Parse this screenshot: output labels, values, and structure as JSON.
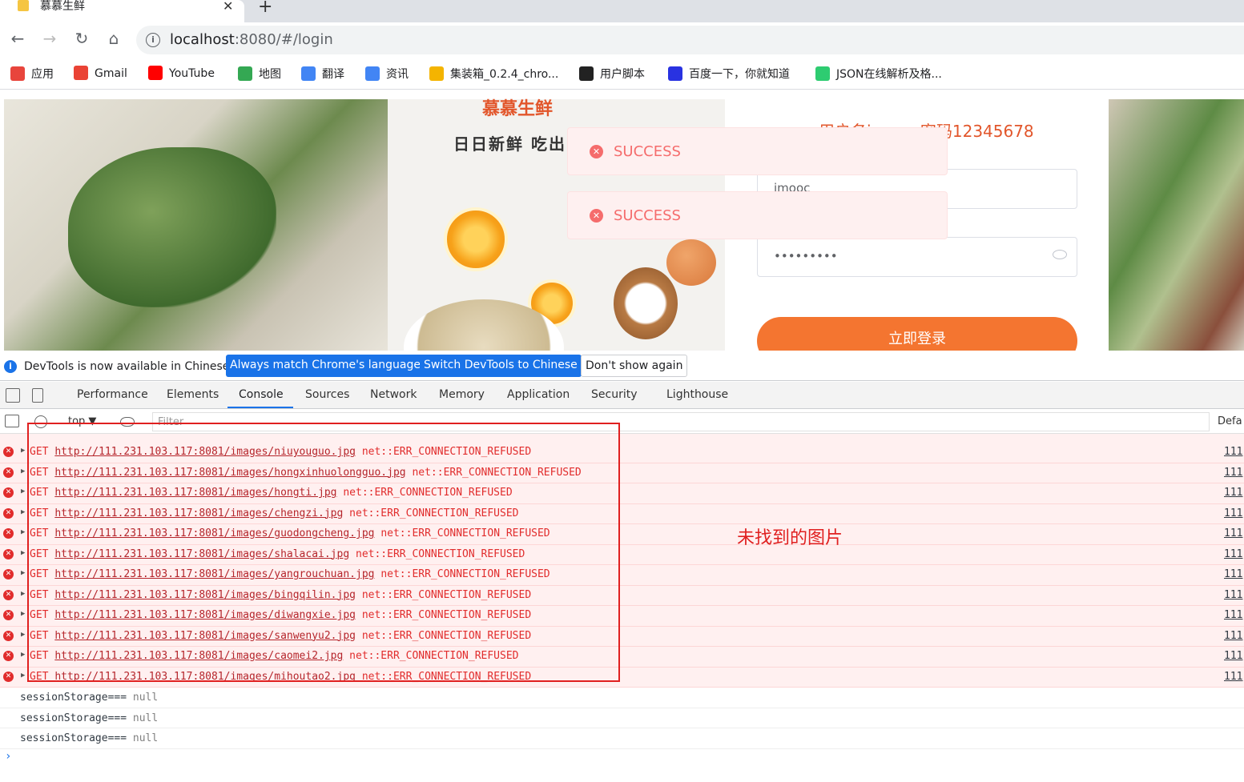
{
  "browser": {
    "tab_title": "慕慕生鲜",
    "url_host": "localhost",
    "url_rest": ":8080/#/login"
  },
  "bookmarks": [
    {
      "label": "应用",
      "icon": "apps-grid-icon",
      "color": "#e8453c"
    },
    {
      "label": "Gmail",
      "icon": "gmail-icon",
      "color": "#ea4335"
    },
    {
      "label": "YouTube",
      "icon": "youtube-icon",
      "color": "#ff0000"
    },
    {
      "label": "地图",
      "icon": "maps-pin-icon",
      "color": "#34a853"
    },
    {
      "label": "翻译",
      "icon": "translate-icon",
      "color": "#4285f4"
    },
    {
      "label": "资讯",
      "icon": "news-icon",
      "color": "#4285f4"
    },
    {
      "label": "集装箱_0.2.4_chro...",
      "icon": "rainbow-icon",
      "color": "#f4b400"
    },
    {
      "label": "用户脚本",
      "icon": "tampermonkey-icon",
      "color": "#222222"
    },
    {
      "label": "百度一下，你就知道",
      "icon": "baidu-paw-icon",
      "color": "#2932e1"
    },
    {
      "label": "JSON在线解析及格...",
      "icon": "json-icon",
      "color": "#2ecc71"
    }
  ],
  "page": {
    "brand": "慕慕生鲜",
    "slogan": "日日新鲜 吃出",
    "hint": "用户名imooc 密码12345678",
    "username_value": "imooc",
    "password_value": "•••••••••",
    "login_button": "立即登录",
    "toasts": [
      "SUCCESS",
      "SUCCESS"
    ]
  },
  "infobar": {
    "text": "DevTools is now available in Chinese!",
    "btn_match": "Always match Chrome's language",
    "btn_switch": "Switch DevTools to Chinese",
    "btn_dismiss": "Don't show again"
  },
  "devtools_tabs": [
    "Performance",
    "Elements",
    "Console",
    "Sources",
    "Network",
    "Memory",
    "Application",
    "Security",
    "Lighthouse"
  ],
  "active_tab": "Console",
  "console_toolbar": {
    "context": "top ▼",
    "filter_placeholder": "Filter",
    "levels": "Defa"
  },
  "errors": [
    {
      "method": "GET",
      "url": "http://111.231.103.117:8081/images/niuyouguo.jpg",
      "error": "net::ERR_CONNECTION_REFUSED",
      "source": "111"
    },
    {
      "method": "GET",
      "url": "http://111.231.103.117:8081/images/hongxinhuolongguo.jpg",
      "error": "net::ERR_CONNECTION_REFUSED",
      "source": "111"
    },
    {
      "method": "GET",
      "url": "http://111.231.103.117:8081/images/hongti.jpg",
      "error": "net::ERR_CONNECTION_REFUSED",
      "source": "111"
    },
    {
      "method": "GET",
      "url": "http://111.231.103.117:8081/images/chengzi.jpg",
      "error": "net::ERR_CONNECTION_REFUSED",
      "source": "111"
    },
    {
      "method": "GET",
      "url": "http://111.231.103.117:8081/images/guodongcheng.jpg",
      "error": "net::ERR_CONNECTION_REFUSED",
      "source": "111"
    },
    {
      "method": "GET",
      "url": "http://111.231.103.117:8081/images/shalacai.jpg",
      "error": "net::ERR_CONNECTION_REFUSED",
      "source": "111"
    },
    {
      "method": "GET",
      "url": "http://111.231.103.117:8081/images/yangrouchuan.jpg",
      "error": "net::ERR_CONNECTION_REFUSED",
      "source": "111"
    },
    {
      "method": "GET",
      "url": "http://111.231.103.117:8081/images/bingqilin.jpg",
      "error": "net::ERR_CONNECTION_REFUSED",
      "source": "111"
    },
    {
      "method": "GET",
      "url": "http://111.231.103.117:8081/images/diwangxie.jpg",
      "error": "net::ERR_CONNECTION_REFUSED",
      "source": "111"
    },
    {
      "method": "GET",
      "url": "http://111.231.103.117:8081/images/sanwenyu2.jpg",
      "error": "net::ERR_CONNECTION_REFUSED",
      "source": "111"
    },
    {
      "method": "GET",
      "url": "http://111.231.103.117:8081/images/caomei2.jpg",
      "error": "net::ERR_CONNECTION_REFUSED",
      "source": "111"
    },
    {
      "method": "GET",
      "url": "http://111.231.103.117:8081/images/mihoutao2.jpg",
      "error": "net::ERR_CONNECTION_REFUSED",
      "source": "111"
    }
  ],
  "logs": [
    {
      "label": "sessionStorage===",
      "value": "null"
    },
    {
      "label": "sessionStorage===",
      "value": "null"
    },
    {
      "label": "sessionStorage===",
      "value": "null"
    }
  ],
  "annotation": "未找到的图片"
}
